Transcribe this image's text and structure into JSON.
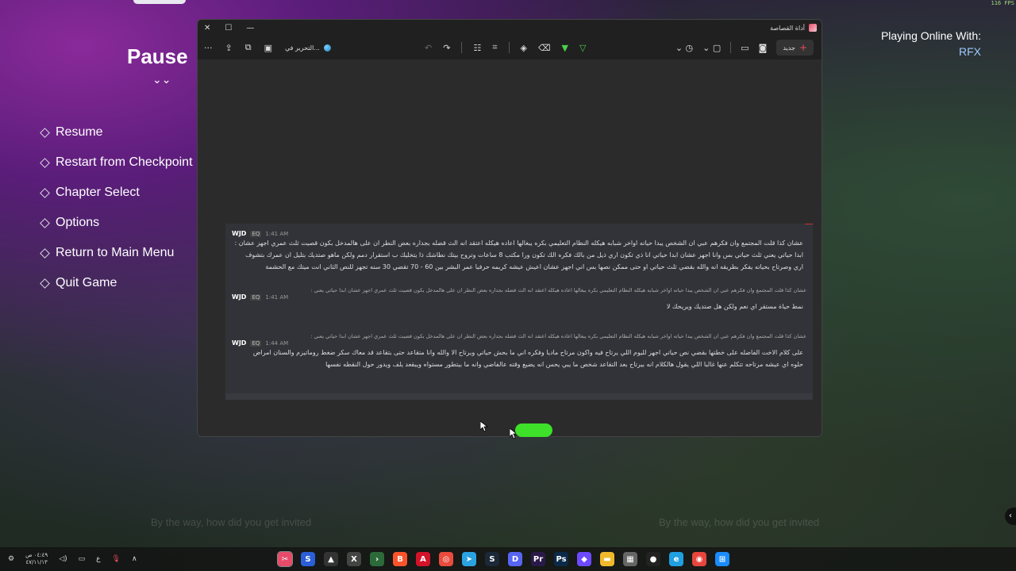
{
  "fps": "116 FPS",
  "pause": {
    "title": "Pause",
    "chevron": "⌄⌄",
    "items": [
      "Resume",
      "Restart from Checkpoint",
      "Chapter Select",
      "Options",
      "Return to Main Menu",
      "Quit Game"
    ]
  },
  "online": {
    "label": "Playing Online With:",
    "name": "RFX"
  },
  "subtitles": {
    "left": "By the way, how did you get invited",
    "right": "By the way, how did you get invited"
  },
  "snip": {
    "app_title": "أداة القصاصة",
    "controls": {
      "close": "✕",
      "maximize": "☐",
      "minimize": "—"
    },
    "toolbar": {
      "more": "···",
      "edit_in": "التحرير في...",
      "new_label": "جديد",
      "new_plus": "+"
    }
  },
  "capture": {
    "messages": [
      {
        "user": "WJD",
        "tag": "EQ",
        "time": "1:41 AM",
        "lines": [
          "عشان كذا قلت المجتمع وان فكرهم عبي ان الشخص يبدا حياته اواخر شبابه هيكله النظام التعليمي بكره يبغالها اعاده هيكله اعتقد انه الث قضله بجداره بعض النطر ان على هالمدخل بكون قصيت ثلث عمري اجهز عشان :",
          "ابدا حياتي يعني ثلث حياتي بس وانا اجهز عشان ابدا حياتي انا ذي تكون اري ذيل من بالك فكره الك تكون ورا مكتب 8 ساعات وتروح بيتك نطاشك ذا يتخليك ب استقرار دمم ولكن ماهو صتديك بتليل ان عمرك بتشوف",
          "اري وصرتاح بحياته يفكر بطريقه انه والله بقضي ثلث حياتي او حتى ممكن نصها بس اني اجهز عشان اعيش عيشه كريمه حرفيا عمر البشر بين 60 - 70 تقضي 30 سنه تجهز للنص الثاني انت ميتك مع الحشمة"
        ]
      },
      {
        "reply": "عشان كذا قلت المجتمع وان فكرهم عبي ان الشخص يبدا حياته اواخر شبابه هيكله النظام التعليمي بكره يبغالها اعاده هيكله اعتقد انه الث قضله بجداره بعض النطر ان على هالمدخل بكون قصيت ثلث عمري اجهز عشان ابدا حياتي يعني :",
        "user": "WJD",
        "tag": "EQ",
        "time": "1:41 AM",
        "lines": [
          "نمط حياة مستقر اي نعم ولكن هل صتديك ويريحك لا"
        ]
      },
      {
        "reply": "عشان كذا قلت المجتمع وان فكرهم عبي ان الشخص يبدا حياته اواخر شبابه هيكله النظام التعليمي بكره يبغالها اعاده هيكله اعتقد انه الث قضله بجداره بعض النطر ان على هالمدخل بكون قصيت ثلث عمري اجهز عشان ابدا حياتي يعني :",
        "user": "WJD",
        "tag": "EQ",
        "time": "1:44 AM",
        "lines": [
          "على كلام الاخت الفاضله على خطتها بقضي نص حياتي اجهز لليوم اللي يرتاح فيه واكون مرتاح ماديا وفكره اني ما بحش حياتي ويرتاح الا والله وانا متقاعد حتى بتقاعد قد معاك سكر ضغط روماتيزم والسنان امراض",
          "حلوه اي عيشه مرتاحه تتكلم عنها غالبا اللي يقول هالكلام انه بيرتاح بعد التقاعد شخص ما يبي يحس انه يضيع وقته عالفاضي وانه ما بيتطور مستواه ويبقعد يلف ويدور حول النقطه نفسها"
        ]
      }
    ]
  },
  "taskbar": {
    "clock_time": "٠٤:٤٩ ص",
    "clock_date": "٤٧/١١/١٣",
    "lang": "ع",
    "apps": [
      {
        "icon": "snipping-tool-icon",
        "glyph": "✂",
        "color": "#e84b6a"
      },
      {
        "icon": "stream-deck-icon",
        "glyph": "S",
        "color": "#2b5fd9"
      },
      {
        "icon": "epic-games-icon",
        "glyph": "▲",
        "color": "#333"
      },
      {
        "icon": "x-app-icon",
        "glyph": "X",
        "color": "#444"
      },
      {
        "icon": "terminal-icon",
        "glyph": "›",
        "color": "#2d6a3a"
      },
      {
        "icon": "brave-icon",
        "glyph": "B",
        "color": "#fb542b"
      },
      {
        "icon": "adobe-icon",
        "glyph": "A",
        "color": "#d4122a"
      },
      {
        "icon": "app-red-icon",
        "glyph": "◎",
        "color": "#e94b3c"
      },
      {
        "icon": "telegram-icon",
        "glyph": "➤",
        "color": "#2aa3e2"
      },
      {
        "icon": "steam-icon",
        "glyph": "S",
        "color": "#1b2838"
      },
      {
        "icon": "discord-icon",
        "glyph": "D",
        "color": "#5865f2"
      },
      {
        "icon": "premiere-icon",
        "glyph": "Pr",
        "color": "#2a1a4a"
      },
      {
        "icon": "photoshop-icon",
        "glyph": "Ps",
        "color": "#0b2a4a"
      },
      {
        "icon": "proton-icon",
        "glyph": "◆",
        "color": "#6d4aff"
      },
      {
        "icon": "file-explorer-icon",
        "glyph": "▬",
        "color": "#f0b92b"
      },
      {
        "icon": "store-icon",
        "glyph": "▦",
        "color": "#666"
      },
      {
        "icon": "github-icon",
        "glyph": "●",
        "color": "#222"
      },
      {
        "icon": "edge-icon",
        "glyph": "e",
        "color": "#1fa0e0"
      },
      {
        "icon": "chrome-icon",
        "glyph": "◉",
        "color": "#e8453c"
      },
      {
        "icon": "start-icon",
        "glyph": "⊞",
        "color": "#1a8cff"
      }
    ]
  },
  "colors": {
    "accent_green": "#3ee02a",
    "online_name": "#9ecbff",
    "new_plus": "#e94b5b"
  }
}
